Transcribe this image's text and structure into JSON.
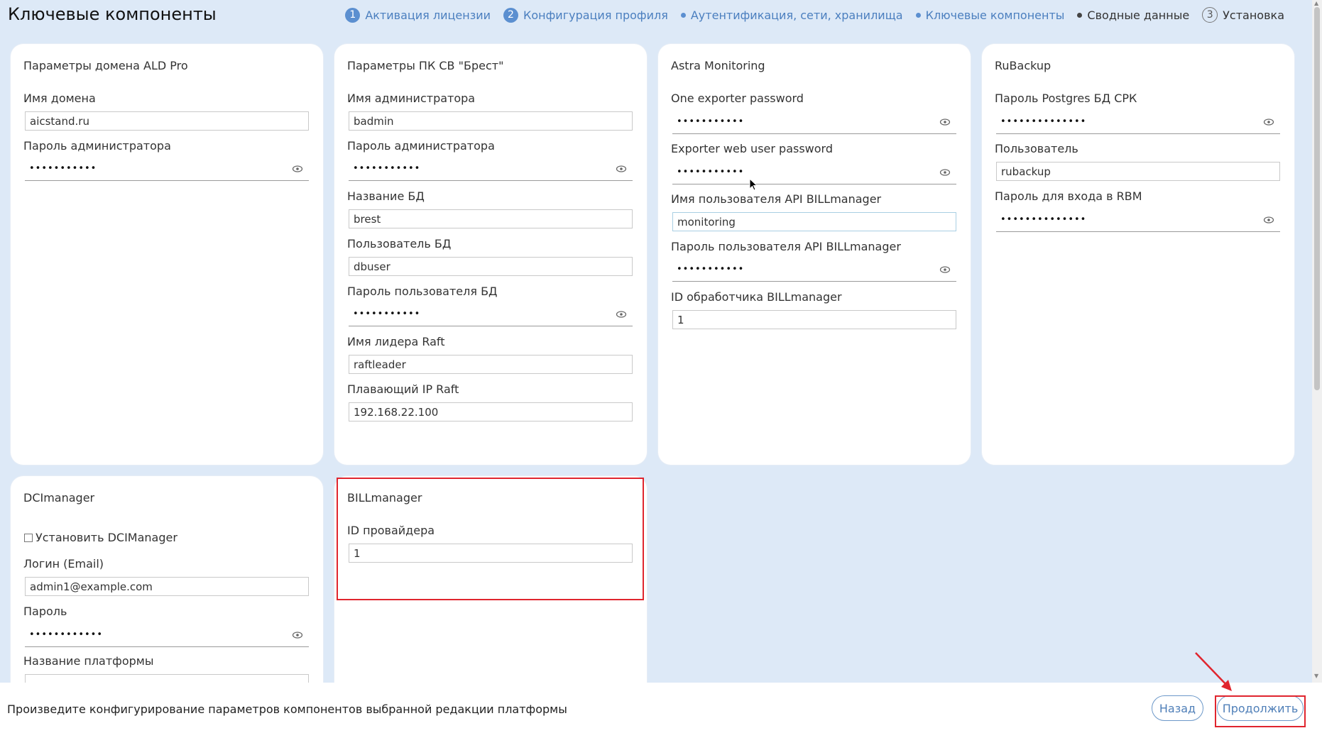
{
  "page_title": "Ключевые компоненты",
  "steps": [
    {
      "num": "1",
      "label": "Активация лицензии"
    },
    {
      "num": "2",
      "label": "Конфигурация профиля"
    },
    {
      "label": "Аутентификация, сети, хранилища"
    },
    {
      "label": "Ключевые компоненты"
    },
    {
      "label": "Сводные данные"
    },
    {
      "num": "3",
      "label": "Установка"
    }
  ],
  "cards": {
    "ald": {
      "title": "Параметры домена ALD Pro",
      "domain_label": "Имя домена",
      "domain_value": "aicstand.ru",
      "admin_pwd_label": "Пароль администратора",
      "admin_pwd_dots": "•••••••••••"
    },
    "brest": {
      "title": "Параметры ПК СВ \"Брест\"",
      "admin_label": "Имя администратора",
      "admin_value": "badmin",
      "admin_pwd_label": "Пароль администратора",
      "admin_pwd_dots": "•••••••••••",
      "db_name_label": "Название БД",
      "db_name_value": "brest",
      "db_user_label": "Пользователь БД",
      "db_user_value": "dbuser",
      "db_pwd_label": "Пароль пользователя БД",
      "db_pwd_dots": "•••••••••••",
      "raft_leader_label": "Имя лидера Raft",
      "raft_leader_value": "raftleader",
      "raft_ip_label": "Плавающий IP Raft",
      "raft_ip_value": "192.168.22.100"
    },
    "astra": {
      "title": "Astra Monitoring",
      "one_exporter_label": "One exporter password",
      "one_exporter_dots": "•••••••••••",
      "exporter_web_label": "Exporter web user password",
      "exporter_web_dots": "•••••••••••",
      "api_user_label": "Имя пользователя API BILLmanager",
      "api_user_value": "monitoring",
      "api_pwd_label": "Пароль пользователя API BILLmanager",
      "api_pwd_dots": "•••••••••••",
      "handler_id_label": "ID обработчика BILLmanager",
      "handler_id_value": "1"
    },
    "rubackup": {
      "title": "RuBackup",
      "pg_pwd_label": "Пароль Postgres БД СРК",
      "pg_pwd_dots": "••••••••••••••",
      "user_label": "Пользователь",
      "user_value": "rubackup",
      "rbm_pwd_label": "Пароль для входа в RBM",
      "rbm_pwd_dots": "••••••••••••••"
    },
    "dci": {
      "title": "DCImanager",
      "install_label": "Установить DCIManager",
      "login_label": "Логин (Email)",
      "login_value": "admin1@example.com",
      "pwd_label": "Пароль",
      "pwd_dots": "••••••••••••",
      "platform_label": "Название платформы"
    },
    "bill": {
      "title": "BILLmanager",
      "provider_id_label": "ID провайдера",
      "provider_id_value": "1"
    }
  },
  "footer": {
    "text": "Произведите конфигурирование параметров компонентов выбранной редакции платформы",
    "back_label": "Назад",
    "continue_label": "Продолжить"
  },
  "colors": {
    "accent": "#5b8fd0",
    "highlight": "#e0252e",
    "background": "#dde9f7"
  }
}
